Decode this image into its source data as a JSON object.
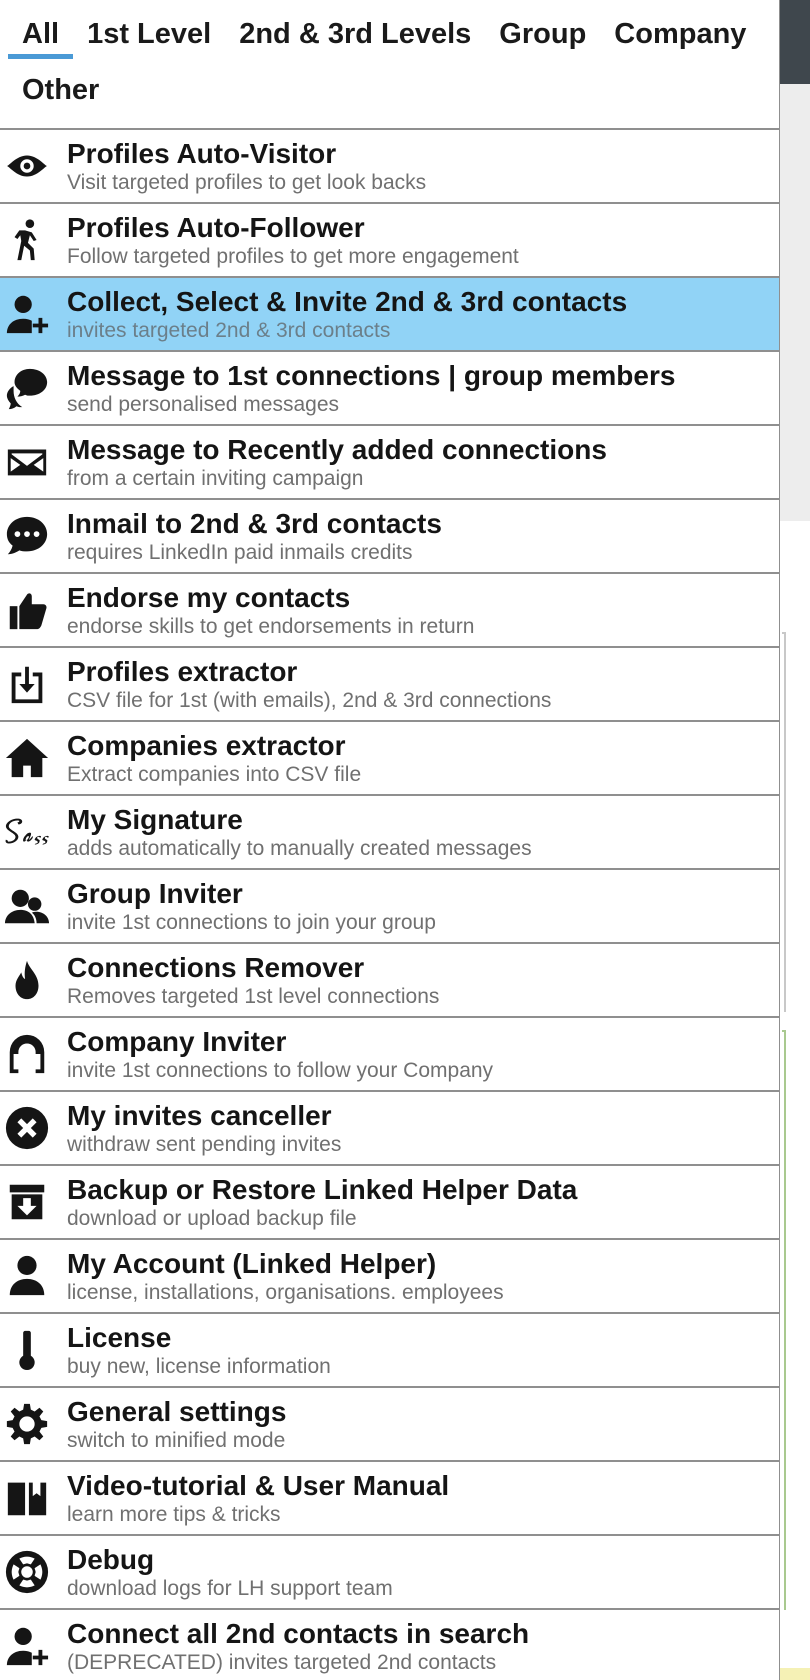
{
  "tabs": [
    {
      "label": "All",
      "active": true
    },
    {
      "label": "1st Level"
    },
    {
      "label": "2nd & 3rd Levels"
    },
    {
      "label": "Group"
    },
    {
      "label": "Company"
    },
    {
      "label": "Other"
    }
  ],
  "items": [
    {
      "icon": "eye-icon",
      "title": "Profiles Auto-Visitor",
      "sub": "Visit targeted profiles to get look backs"
    },
    {
      "icon": "walking-person-icon",
      "title": "Profiles Auto-Follower",
      "sub": "Follow targeted profiles to get more engagement"
    },
    {
      "icon": "user-plus-icon",
      "title": "Collect, Select & Invite 2nd & 3rd contacts",
      "sub": "invites targeted 2nd & 3rd contacts",
      "selected": true
    },
    {
      "icon": "chat-bubbles-icon",
      "title": "Message to 1st connections | group members",
      "sub": "send personalised messages"
    },
    {
      "icon": "envelope-icon",
      "title": "Message to Recently added connections",
      "sub": "from a certain inviting campaign"
    },
    {
      "icon": "chat-dots-icon",
      "title": "Inmail to 2nd & 3rd contacts",
      "sub": "requires LinkedIn paid inmails credits"
    },
    {
      "icon": "thumbs-up-icon",
      "title": "Endorse my contacts",
      "sub": "endorse skills to get endorsements in return"
    },
    {
      "icon": "download-box-icon",
      "title": "Profiles extractor",
      "sub": "CSV file for 1st (with emails), 2nd & 3rd connections"
    },
    {
      "icon": "home-icon",
      "title": "Companies extractor",
      "sub": "Extract companies into CSV file"
    },
    {
      "icon": "sass-signature-icon",
      "title": "My Signature",
      "sub": "adds automatically to manually created messages"
    },
    {
      "icon": "users-group-icon",
      "title": "Group Inviter",
      "sub": "invite 1st connections to join your group"
    },
    {
      "icon": "fire-icon",
      "title": "Connections Remover",
      "sub": "Removes targeted 1st level connections"
    },
    {
      "icon": "magnet-icon",
      "title": "Company Inviter",
      "sub": "invite 1st connections to follow your Company"
    },
    {
      "icon": "close-circle-icon",
      "title": "My invites canceller",
      "sub": "withdraw sent pending invites"
    },
    {
      "icon": "archive-icon",
      "title": "Backup or Restore Linked Helper Data",
      "sub": "download or upload backup file"
    },
    {
      "icon": "user-icon",
      "title": "My Account (Linked Helper)",
      "sub": "license, installations, organisations. employees"
    },
    {
      "icon": "thermometer-icon",
      "title": "License",
      "sub": "buy new, license information"
    },
    {
      "icon": "gear-icon",
      "title": "General settings",
      "sub": "switch to minified mode"
    },
    {
      "icon": "book-icon",
      "title": "Video-tutorial & User Manual",
      "sub": "learn more tips & tricks"
    },
    {
      "icon": "lifebuoy-icon",
      "title": "Debug",
      "sub": "download logs for LH support team"
    },
    {
      "icon": "user-plus-icon",
      "title": "Connect all 2nd contacts in search",
      "sub": "(DEPRECATED) invites targeted 2nd contacts"
    }
  ]
}
